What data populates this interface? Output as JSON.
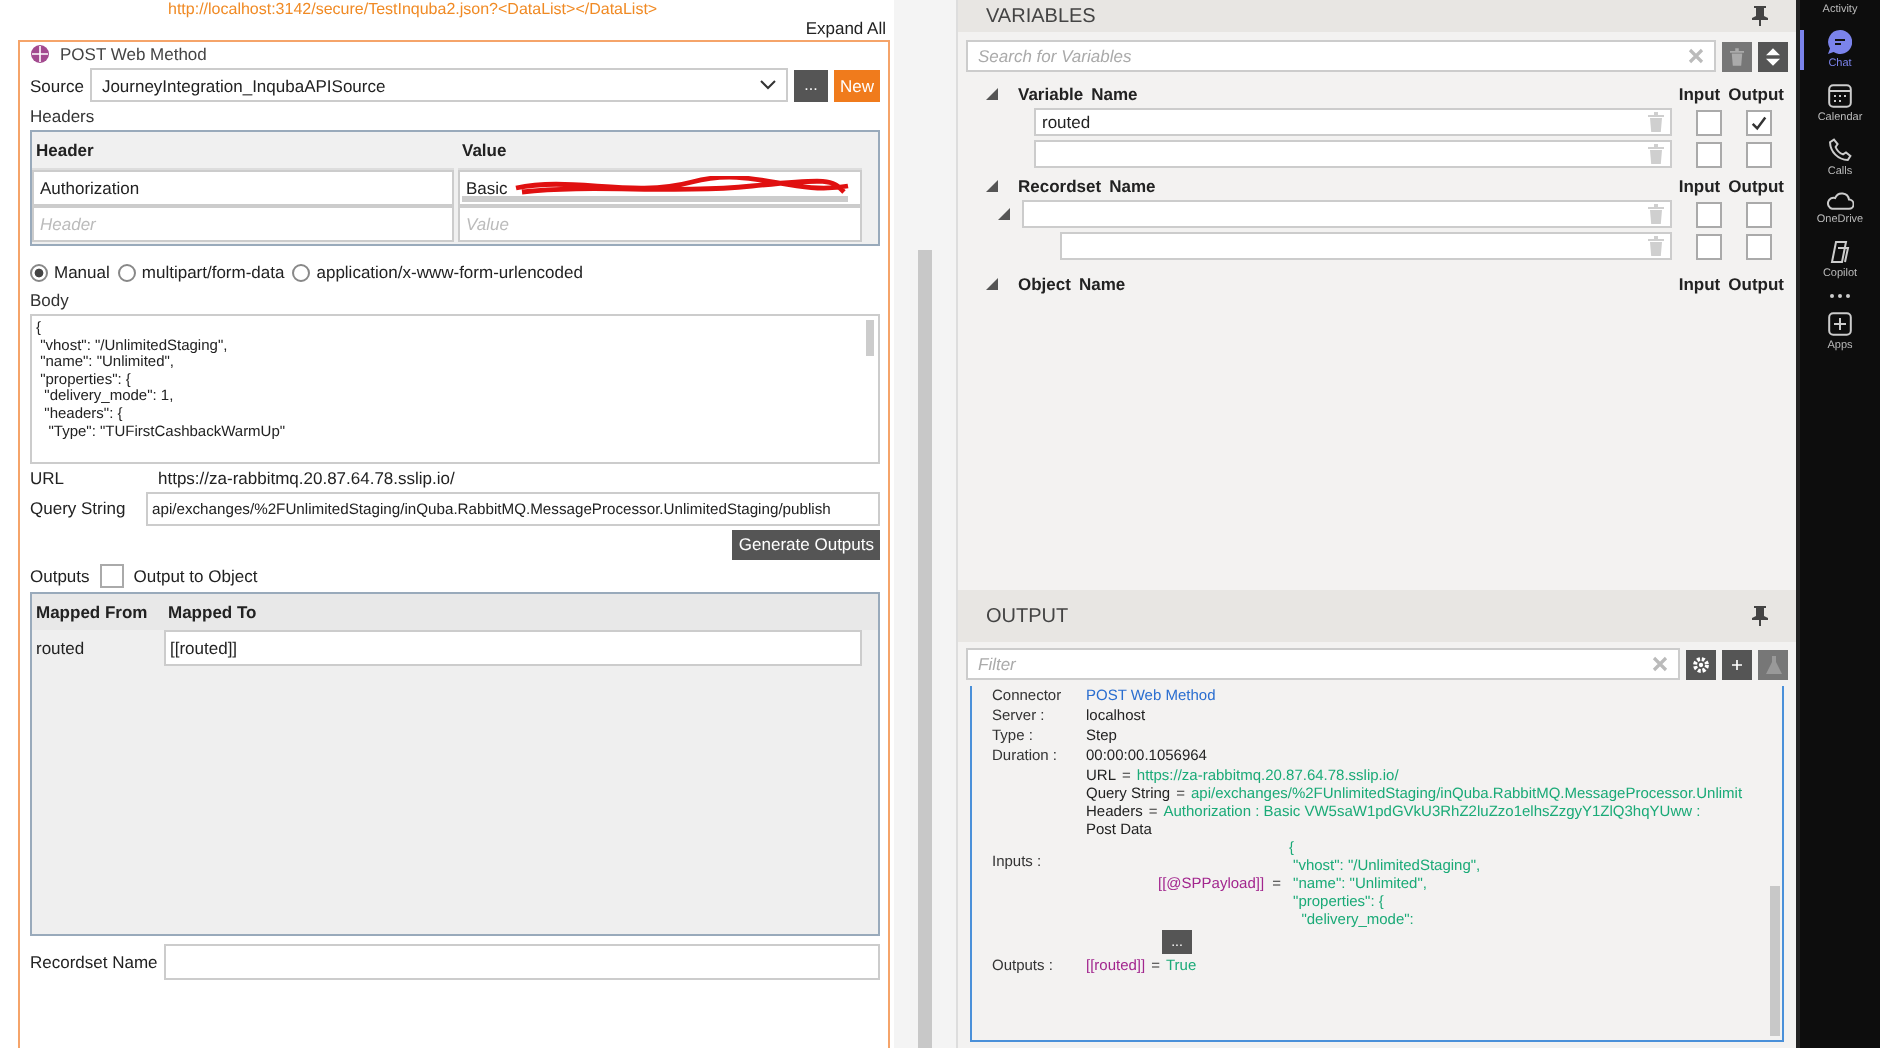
{
  "designer": {
    "url_text": "http://localhost:3142/secure/TestInquba2.json?<DataList></DataList>",
    "expand_all": "Expand All",
    "activity": {
      "title": "POST Web Method",
      "source_label": "Source",
      "source_value": "JourneyIntegration_InqubaAPISource",
      "browse_button": "...",
      "new_button": "New",
      "headers_label": "Headers",
      "headers_table": {
        "columns": [
          "Header",
          "Value"
        ],
        "rows": [
          {
            "header": "Authorization",
            "value": "Basic",
            "redacted": true
          }
        ],
        "empty_row": {
          "header": {
            "placeholder": "Header"
          },
          "value": {
            "placeholder": "Value"
          }
        }
      },
      "body_types": [
        {
          "label": "Manual",
          "selected": true
        },
        {
          "label": "multipart/form-data",
          "selected": false
        },
        {
          "label": "application/x-www-form-urlencoded",
          "selected": false
        }
      ],
      "body_label": "Body",
      "body_lines": [
        "{",
        " \"vhost\": \"/UnlimitedStaging\",",
        " \"name\": \"Unlimited\",",
        " \"properties\": {",
        "  \"delivery_mode\": 1,",
        "  \"headers\": {",
        "   \"Type\": \"TUFirstCashbackWarmUp\""
      ],
      "url_label": "URL",
      "url_value": "https://za-rabbitmq.20.87.64.78.sslip.io/",
      "query_label": "Query String",
      "query_value": "api/exchanges/%2FUnlimitedStaging/inQuba.RabbitMQ.MessageProcessor.UnlimitedStaging/publish",
      "generate_button": "Generate Outputs",
      "outputs_label": "Outputs",
      "output_to_object": {
        "label": "Output to Object",
        "checked": false
      },
      "mapping": {
        "columns": [
          "Mapped From",
          "Mapped To"
        ],
        "rows": [
          {
            "from": "routed",
            "to": "[[routed]]"
          }
        ]
      },
      "recordset_label": "Recordset Name"
    }
  },
  "variables": {
    "title": "VARIABLES",
    "search_placeholder": "Search for Variables",
    "sections": [
      {
        "kind": "variable",
        "label": "Variable",
        "name_label": "Name",
        "input_label": "Input",
        "output_label": "Output",
        "rows": [
          {
            "name": "routed",
            "input": false,
            "output": true
          },
          {
            "input": false,
            "output": false
          }
        ]
      },
      {
        "kind": "recordset",
        "label": "Recordset",
        "name_label": "Name",
        "input_label": "Input",
        "output_label": "Output",
        "rows": [
          {
            "input": false,
            "output": false,
            "children": [
              {
                "input": false,
                "output": false
              }
            ]
          }
        ]
      },
      {
        "kind": "object",
        "label": "Object",
        "name_label": "Name",
        "input_label": "Input",
        "output_label": "Output"
      }
    ]
  },
  "output": {
    "title": "OUTPUT",
    "filter_placeholder": "Filter",
    "details": [
      {
        "label": "Connector",
        "value": "POST Web Method"
      },
      {
        "label": "Server :",
        "value": "localhost"
      },
      {
        "label": "Type :",
        "value": "Step"
      },
      {
        "label": "Duration :",
        "value": "00:00:00.1056964"
      }
    ],
    "inputs": {
      "label": "Inputs :",
      "entries": [
        {
          "name": "URL",
          "sign": "=",
          "value": "https://za-rabbitmq.20.87.64.78.sslip.io/"
        },
        {
          "name": "Query String",
          "sign": "=",
          "value": "api/exchanges/%2FUnlimitedStaging/inQuba.RabbitMQ.MessageProcessor.Unlimit"
        },
        {
          "name": "Headers",
          "sign": "=",
          "value": "Authorization : Basic VW5saW1pdGVkU3RhZ2luZzo1elhsZzgyY1ZlQ3hqYUww  :"
        },
        {
          "name": "Post Data"
        }
      ],
      "payload": {
        "variable": "[[@SPPayload]]",
        "sign": "=",
        "lines": [
          "{",
          " \"vhost\": \"/UnlimitedStaging\",",
          " \"name\": \"Unlimited\",",
          " \"properties\": {",
          "   \"delivery_mode\":"
        ]
      },
      "more_button": "..."
    },
    "outputs": {
      "label": "Outputs :",
      "variable": "[[routed]]",
      "sign": "=",
      "value": "True"
    }
  },
  "teams_bar": {
    "items": [
      {
        "kind": "activity",
        "label": "Activity",
        "selected": false
      },
      {
        "kind": "chat",
        "label": "Chat",
        "selected": true
      },
      {
        "kind": "calendar",
        "label": "Calendar",
        "selected": false
      },
      {
        "kind": "calls",
        "label": "Calls",
        "selected": false
      },
      {
        "kind": "onedrive",
        "label": "OneDrive",
        "selected": false
      },
      {
        "kind": "copilot",
        "label": "Copilot",
        "selected": false
      },
      {
        "kind": "more",
        "selected": false
      },
      {
        "kind": "apps",
        "label": "Apps",
        "selected": false
      }
    ]
  }
}
